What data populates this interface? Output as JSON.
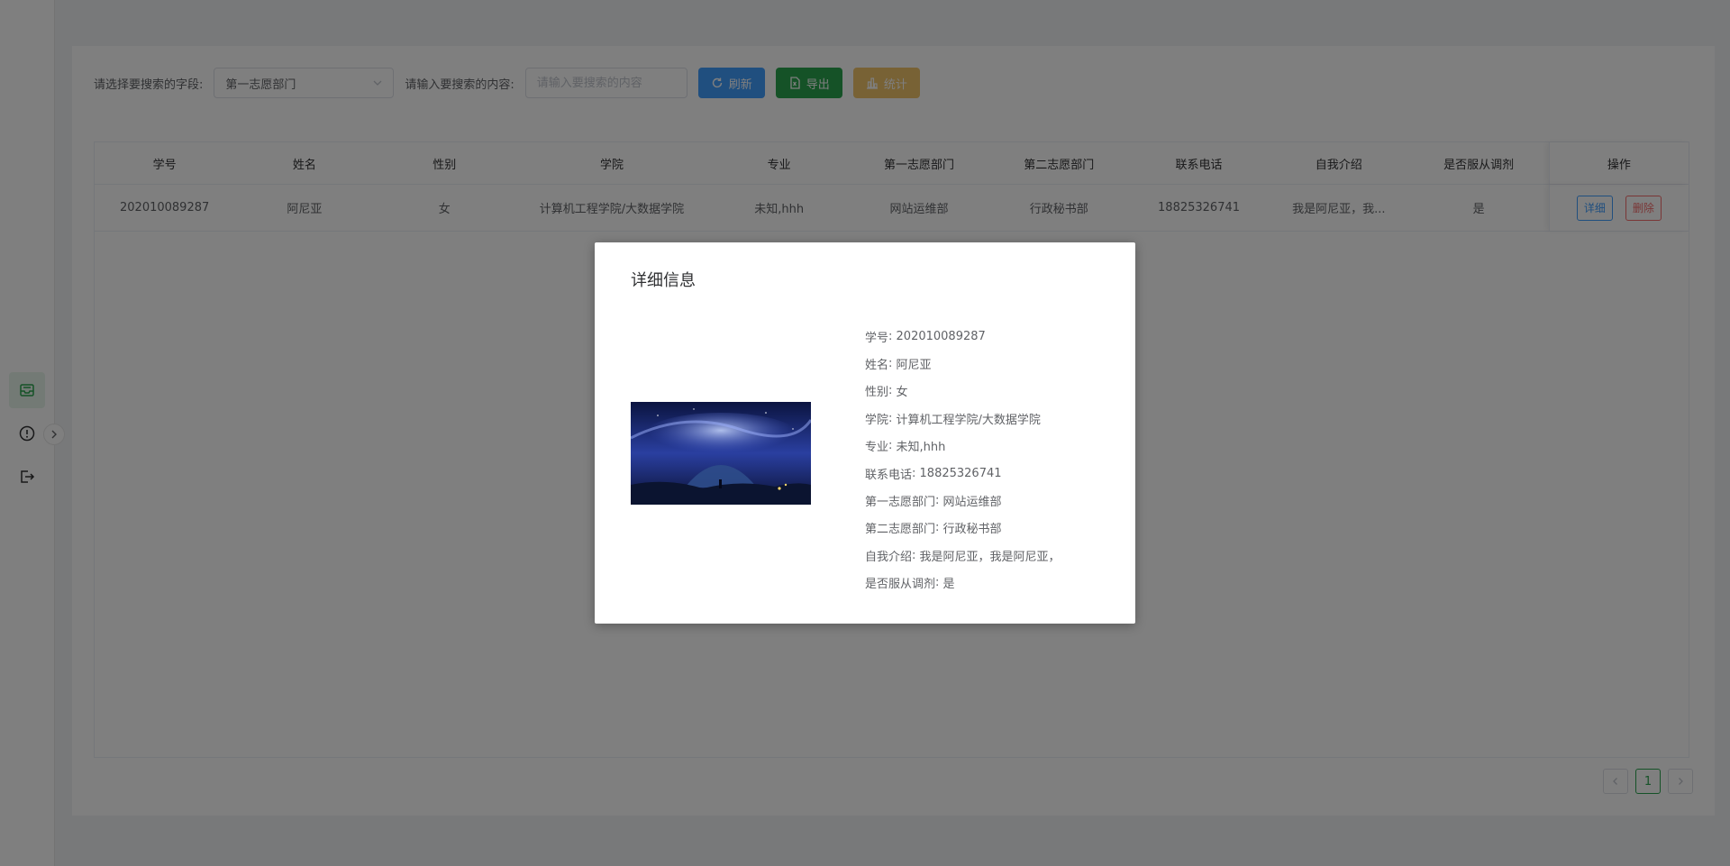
{
  "toolbar": {
    "field_label": "请选择要搜索的字段:",
    "field_value": "第一志愿部门",
    "content_label": "请输入要搜索的内容:",
    "content_placeholder": "请输入要搜索的内容",
    "refresh_label": "刷新",
    "export_label": "导出",
    "stats_label": "统计"
  },
  "table": {
    "columns": [
      "学号",
      "姓名",
      "性别",
      "学院",
      "专业",
      "第一志愿部门",
      "第二志愿部门",
      "联系电话",
      "自我介绍",
      "是否服从调剂",
      "操作"
    ],
    "rows": [
      {
        "student_id": "202010089287",
        "name": "阿尼亚",
        "gender": "女",
        "college": "计算机工程学院/大数据学院",
        "major": "未知,hhh",
        "first_choice": "网站运维部",
        "second_choice": "行政秘书部",
        "phone": "18825326741",
        "intro": "我是阿尼亚，我...",
        "obey": "是",
        "detail_label": "详细",
        "delete_label": "删除"
      }
    ]
  },
  "pagination": {
    "current": "1",
    "prev_icon": "chevron-left-icon",
    "next_icon": "chevron-right-icon"
  },
  "dialog": {
    "title": "详细信息",
    "fields": [
      {
        "label": "学号",
        "value": "202010089287"
      },
      {
        "label": "姓名",
        "value": "阿尼亚"
      },
      {
        "label": "性别",
        "value": "女"
      },
      {
        "label": "学院",
        "value": "计算机工程学院/大数据学院"
      },
      {
        "label": "专业",
        "value": "未知,hhh"
      },
      {
        "label": "联系电话",
        "value": "18825326741"
      },
      {
        "label": "第一志愿部门",
        "value": "网站运维部"
      },
      {
        "label": "第二志愿部门",
        "value": "行政秘书部"
      },
      {
        "label": "自我介绍",
        "value": "我是阿尼亚，我是阿尼亚，"
      },
      {
        "label": "是否服从调剂",
        "value": "是"
      }
    ]
  },
  "colors": {
    "primary": "#409eff",
    "success": "#2aa44f",
    "warning": "#f0c46a",
    "danger": "#f56c6c"
  }
}
